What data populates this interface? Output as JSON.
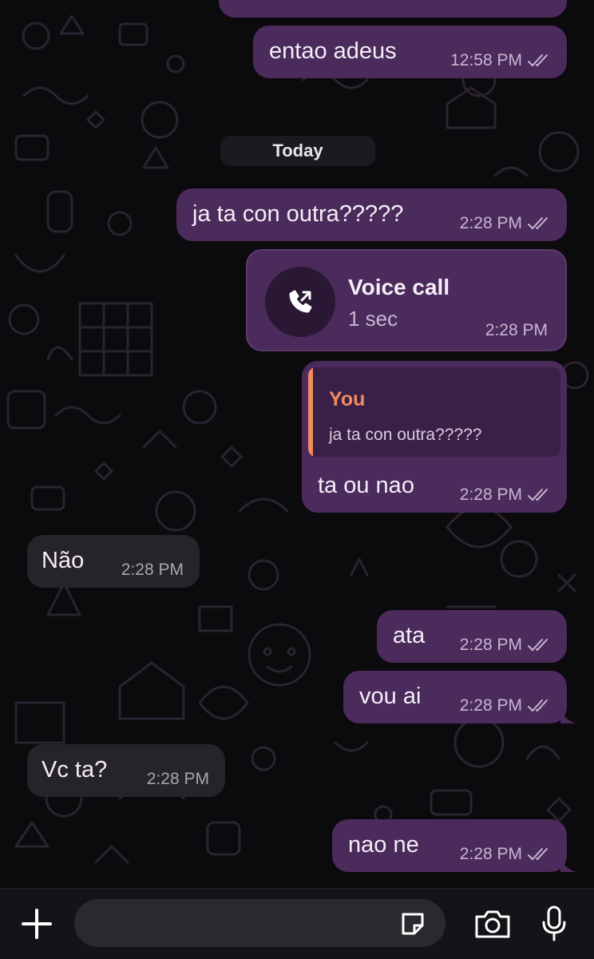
{
  "chat": {
    "date_separator": "Today",
    "messages": [
      {
        "text": "entao adeus",
        "time": "12:58 PM",
        "direction": "outgoing",
        "status": "read"
      },
      {
        "text": "ja ta con outra?????",
        "time": "2:28 PM",
        "direction": "outgoing",
        "status": "read"
      },
      {
        "type": "call",
        "title": "Voice call",
        "duration": "1 sec",
        "time": "2:28 PM",
        "direction": "outgoing"
      },
      {
        "text": "ta ou nao",
        "time": "2:28 PM",
        "direction": "outgoing",
        "status": "read",
        "reply": {
          "author": "You",
          "text": "ja ta con outra?????"
        }
      },
      {
        "text": "Não",
        "time": "2:28 PM",
        "direction": "incoming"
      },
      {
        "text": "ata",
        "time": "2:28 PM",
        "direction": "outgoing",
        "status": "read"
      },
      {
        "text": "vou ai",
        "time": "2:28 PM",
        "direction": "outgoing",
        "status": "read"
      },
      {
        "text": "Vc ta?",
        "time": "2:28 PM",
        "direction": "incoming"
      },
      {
        "text": "nao ne",
        "time": "2:28 PM",
        "direction": "outgoing",
        "status": "read"
      }
    ]
  },
  "composer": {
    "input_value": "",
    "icons": [
      "plus-icon",
      "sticker-icon",
      "camera-icon",
      "microphone-icon"
    ]
  },
  "colors": {
    "outgoing_bubble": "#4b2a5c",
    "incoming_bubble": "#262428",
    "reply_accent": "#f08a62",
    "background": "#0b0a0d"
  }
}
